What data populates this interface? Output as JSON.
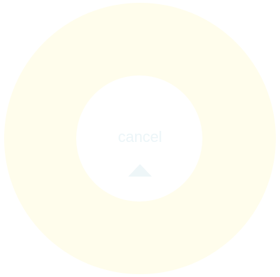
{
  "pie_menu": {
    "center_label": "cancel",
    "center_icon": "caret-up-icon",
    "colors": {
      "ring": "#fffdec",
      "hub": "#ffffff",
      "label": "#ecf5f8"
    }
  }
}
